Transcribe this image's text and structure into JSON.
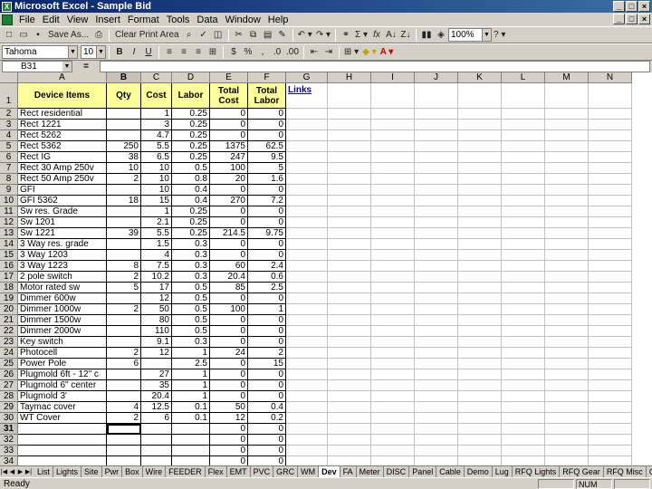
{
  "window": {
    "title": "Microsoft Excel - Sample Bid"
  },
  "menu": [
    "File",
    "Edit",
    "View",
    "Insert",
    "Format",
    "Tools",
    "Data",
    "Window",
    "Help"
  ],
  "toolbar": {
    "save_as": "Save As...",
    "clear_print": "Clear Print Area",
    "zoom": "100%"
  },
  "format_bar": {
    "font": "Tahoma",
    "size": "10"
  },
  "name_box": "B31",
  "formula_eq": "=",
  "columns": [
    "A",
    "B",
    "C",
    "D",
    "E",
    "F",
    "G",
    "H",
    "I",
    "J",
    "K",
    "L",
    "M",
    "N"
  ],
  "header_row": {
    "a": "Device Items",
    "b": "Qty",
    "c": "Cost",
    "d": "Labor",
    "e": "Total Cost",
    "f": "Total Labor",
    "g": "Links"
  },
  "rows": [
    {
      "n": "2",
      "a": "Rect residential",
      "b": "",
      "c": "1",
      "d": "0.25",
      "e": "0",
      "f": "0"
    },
    {
      "n": "3",
      "a": "Rect 1221",
      "b": "",
      "c": "3",
      "d": "0.25",
      "e": "0",
      "f": "0"
    },
    {
      "n": "4",
      "a": "Rect 5262",
      "b": "",
      "c": "4.7",
      "d": "0.25",
      "e": "0",
      "f": "0"
    },
    {
      "n": "5",
      "a": "Rect 5362",
      "b": "250",
      "c": "5.5",
      "d": "0.25",
      "e": "1375",
      "f": "62.5"
    },
    {
      "n": "6",
      "a": "Rect IG",
      "b": "38",
      "c": "6.5",
      "d": "0.25",
      "e": "247",
      "f": "9.5"
    },
    {
      "n": "7",
      "a": "Rect 30 Amp 250v",
      "b": "10",
      "c": "10",
      "d": "0.5",
      "e": "100",
      "f": "5"
    },
    {
      "n": "8",
      "a": "Rect 50 Amp 250v",
      "b": "2",
      "c": "10",
      "d": "0.8",
      "e": "20",
      "f": "1.6"
    },
    {
      "n": "9",
      "a": "GFI",
      "b": "",
      "c": "10",
      "d": "0.4",
      "e": "0",
      "f": "0"
    },
    {
      "n": "10",
      "a": "GFI 5362",
      "b": "18",
      "c": "15",
      "d": "0.4",
      "e": "270",
      "f": "7.2"
    },
    {
      "n": "11",
      "a": "Sw res. Grade",
      "b": "",
      "c": "1",
      "d": "0.25",
      "e": "0",
      "f": "0"
    },
    {
      "n": "12",
      "a": "Sw 1201",
      "b": "",
      "c": "2.1",
      "d": "0.25",
      "e": "0",
      "f": "0"
    },
    {
      "n": "13",
      "a": "Sw 1221",
      "b": "39",
      "c": "5.5",
      "d": "0.25",
      "e": "214.5",
      "f": "9.75"
    },
    {
      "n": "14",
      "a": "3 Way res. grade",
      "b": "",
      "c": "1.5",
      "d": "0.3",
      "e": "0",
      "f": "0"
    },
    {
      "n": "15",
      "a": "3 Way 1203",
      "b": "",
      "c": "4",
      "d": "0.3",
      "e": "0",
      "f": "0"
    },
    {
      "n": "16",
      "a": "3 Way 1223",
      "b": "8",
      "c": "7.5",
      "d": "0.3",
      "e": "60",
      "f": "2.4"
    },
    {
      "n": "17",
      "a": "2 pole switch",
      "b": "2",
      "c": "10.2",
      "d": "0.3",
      "e": "20.4",
      "f": "0.6"
    },
    {
      "n": "18",
      "a": "Motor rated sw",
      "b": "5",
      "c": "17",
      "d": "0.5",
      "e": "85",
      "f": "2.5"
    },
    {
      "n": "19",
      "a": "Dimmer 600w",
      "b": "",
      "c": "12",
      "d": "0.5",
      "e": "0",
      "f": "0"
    },
    {
      "n": "20",
      "a": "Dimmer 1000w",
      "b": "2",
      "c": "50",
      "d": "0.5",
      "e": "100",
      "f": "1"
    },
    {
      "n": "21",
      "a": "Dimmer 1500w",
      "b": "",
      "c": "80",
      "d": "0.5",
      "e": "0",
      "f": "0"
    },
    {
      "n": "22",
      "a": "Dimmer 2000w",
      "b": "",
      "c": "110",
      "d": "0.5",
      "e": "0",
      "f": "0"
    },
    {
      "n": "23",
      "a": "Key switch",
      "b": "",
      "c": "9.1",
      "d": "0.3",
      "e": "0",
      "f": "0"
    },
    {
      "n": "24",
      "a": "Photocell",
      "b": "2",
      "c": "12",
      "d": "1",
      "e": "24",
      "f": "2"
    },
    {
      "n": "25",
      "a": "Power Pole",
      "b": "6",
      "c": "",
      "d": "2.5",
      "e": "0",
      "f": "15"
    },
    {
      "n": "26",
      "a": "Plugmold 6ft - 12\" c",
      "b": "",
      "c": "27",
      "d": "1",
      "e": "0",
      "f": "0"
    },
    {
      "n": "27",
      "a": "Plugmold 6\" center",
      "b": "",
      "c": "35",
      "d": "1",
      "e": "0",
      "f": "0"
    },
    {
      "n": "28",
      "a": "Plugmold 3'",
      "b": "",
      "c": "20.4",
      "d": "1",
      "e": "0",
      "f": "0"
    },
    {
      "n": "29",
      "a": "Taymac cover",
      "b": "4",
      "c": "12.5",
      "d": "0.1",
      "e": "50",
      "f": "0.4"
    },
    {
      "n": "30",
      "a": "WT Cover",
      "b": "2",
      "c": "6",
      "d": "0.1",
      "e": "12",
      "f": "0.2"
    },
    {
      "n": "31",
      "a": "",
      "b": "",
      "c": "",
      "d": "",
      "e": "0",
      "f": "0"
    },
    {
      "n": "32",
      "a": "",
      "b": "",
      "c": "",
      "d": "",
      "e": "0",
      "f": "0"
    },
    {
      "n": "33",
      "a": "",
      "b": "",
      "c": "",
      "d": "",
      "e": "0",
      "f": "0"
    },
    {
      "n": "34",
      "a": "",
      "b": "",
      "c": "",
      "d": "",
      "e": "0",
      "f": "0"
    }
  ],
  "sheet_tabs": [
    "List",
    "Lights",
    "Site",
    "Pwr",
    "Box",
    "Wire",
    "FEEDER",
    "Flex",
    "EMT",
    "PVC",
    "GRC",
    "WM",
    "Dev",
    "FA",
    "Meter",
    "DISC",
    "Panel",
    "Cable",
    "Demo",
    "Lug",
    "RFQ Lights",
    "RFQ Gear",
    "RFQ Misc",
    "Quote"
  ],
  "active_tab": "Dev",
  "status": {
    "left": "Ready",
    "num": "NUM"
  },
  "colors": {
    "header_fill": "#ffff99",
    "link": "#0000cc",
    "title_bar": "#0a246a"
  }
}
